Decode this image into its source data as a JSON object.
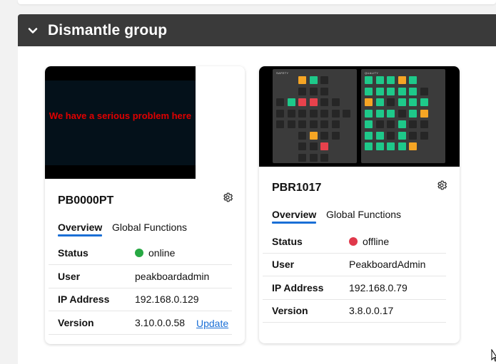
{
  "group": {
    "title": "Dismantle group",
    "chevron_icon": "chevron-down-icon"
  },
  "boxes": [
    {
      "name": "PB0000PT",
      "preview_message": "We have a serious problem here",
      "tabs": [
        "Overview",
        "Global Functions"
      ],
      "details": [
        {
          "label": "Status",
          "value": "online",
          "status_color": "#27a843"
        },
        {
          "label": "User",
          "value": "peakboardadmin"
        },
        {
          "label": "IP Address",
          "value": "192.168.0.129"
        },
        {
          "label": "Version",
          "value": "3.10.0.0.58",
          "action": "Update"
        }
      ]
    },
    {
      "name": "PBR1017",
      "preview_panels": [
        "SAFETY",
        "QUALITY"
      ],
      "tabs": [
        "Overview",
        "Global Functions"
      ],
      "details": [
        {
          "label": "Status",
          "value": "offline",
          "status_color": "#e0384b"
        },
        {
          "label": "User",
          "value": "PeakboardAdmin"
        },
        {
          "label": "IP Address",
          "value": "192.168.0.79"
        },
        {
          "label": "Version",
          "value": "3.8.0.0.17"
        }
      ]
    }
  ],
  "colors": {
    "accent": "#1a6fd6",
    "header_bg": "#3a3a3a"
  }
}
